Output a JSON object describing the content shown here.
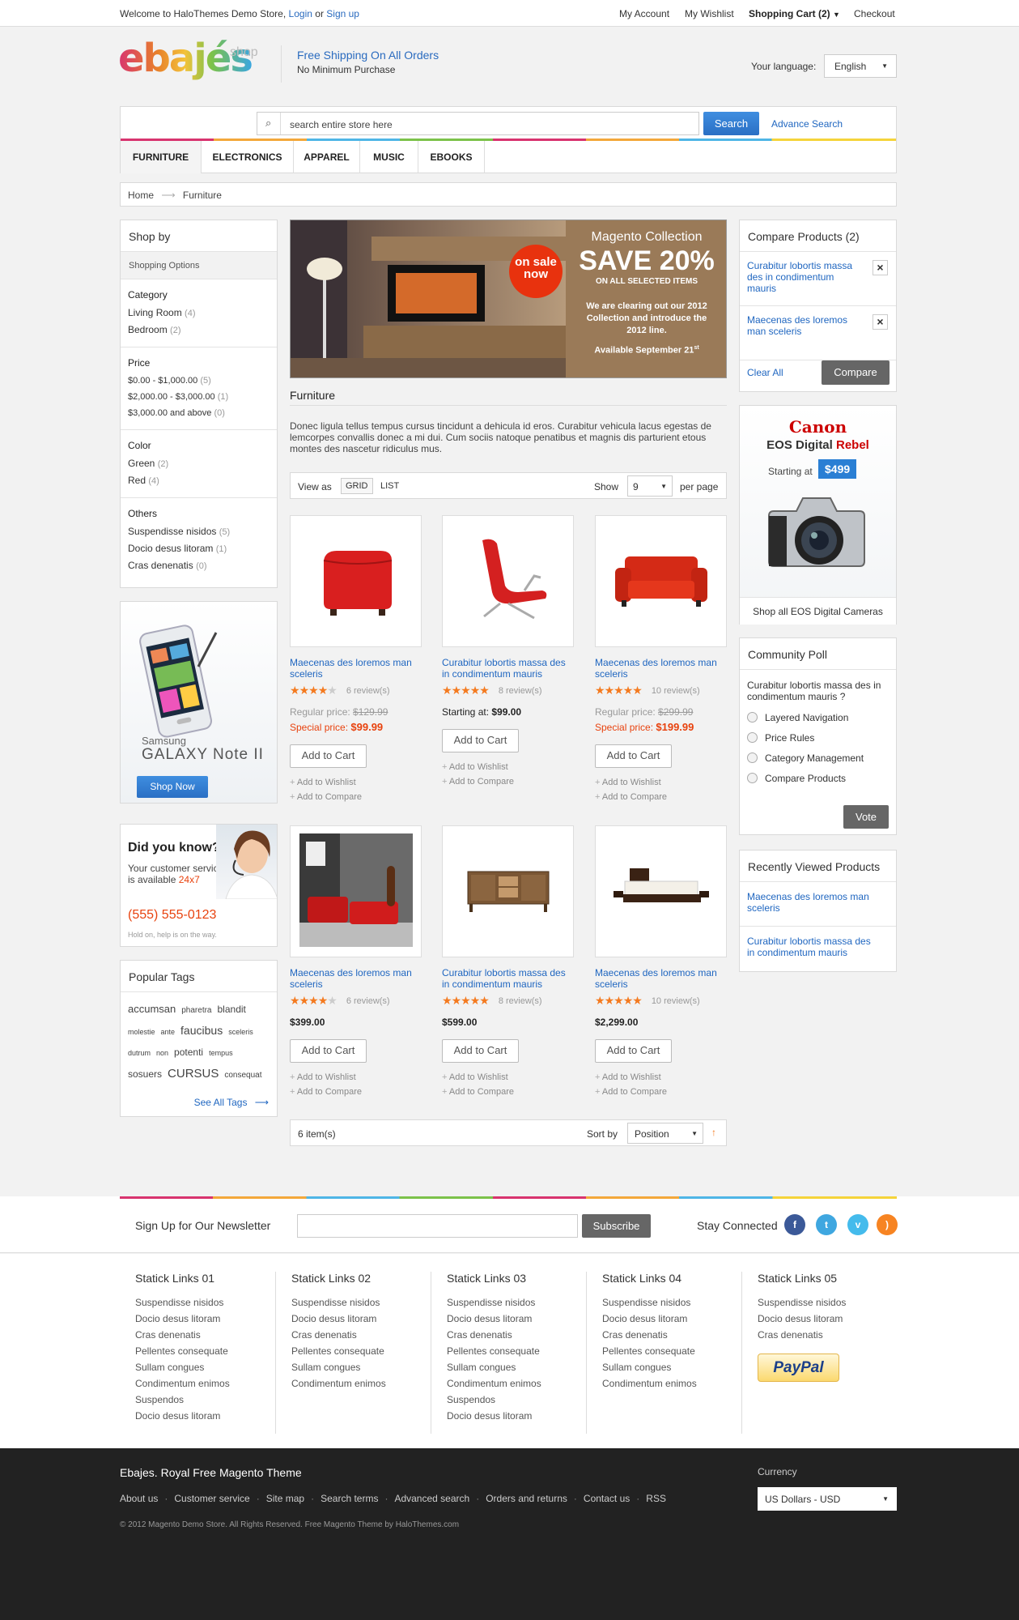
{
  "topbar": {
    "welcome": "Welcome to HaloThemes Demo Store,",
    "login": "Login",
    "or": "or",
    "signup": "Sign up",
    "my_account": "My Account",
    "my_wishlist": "My Wishlist",
    "shopping_cart": "Shopping Cart (2)",
    "checkout": "Checkout"
  },
  "header": {
    "logo_text": "ebajés",
    "logo_shop": "shop",
    "shipping_title": "Free Shipping On All Orders",
    "shipping_sub": "No Minimum Purchase",
    "language_label": "Your language:",
    "language_value": "English"
  },
  "search": {
    "placeholder": "search entire store here",
    "button": "Search",
    "advance": "Advance Search"
  },
  "nav": [
    "FURNITURE",
    "ELECTRONICS",
    "APPAREL",
    "MUSIC",
    "EBOOKS"
  ],
  "breadcrumb": {
    "home": "Home",
    "current": "Furniture"
  },
  "shopby": {
    "title": "Shop by",
    "subtitle": "Shopping Options",
    "groups": [
      {
        "title": "Category",
        "items": [
          {
            "label": "Living Room",
            "count": "(4)"
          },
          {
            "label": "Bedroom",
            "count": "(2)"
          }
        ]
      },
      {
        "title": "Price",
        "items": [
          {
            "label": "$0.00 - $1,000.00",
            "count": "(5)"
          },
          {
            "label": "$2,000.00 - $3,000.00",
            "count": "(1)"
          },
          {
            "label": "$3,000.00 and above",
            "count": "(0)"
          }
        ]
      },
      {
        "title": "Color",
        "items": [
          {
            "label": "Green",
            "count": "(2)"
          },
          {
            "label": "Red",
            "count": "(4)"
          }
        ]
      },
      {
        "title": "Others",
        "items": [
          {
            "label": "Suspendisse nisidos",
            "count": "(5)"
          },
          {
            "label": "Docio desus litoram",
            "count": "(1)"
          },
          {
            "label": "Cras denenatis",
            "count": "(0)"
          }
        ]
      }
    ]
  },
  "samsung_ad": {
    "brand": "Samsung",
    "model": "GALAXY Note",
    "model_suffix": "II",
    "button": "Shop Now"
  },
  "did_you_know": {
    "title": "Did you know?",
    "line1": "Your customer service",
    "line2": "is available",
    "hours": "24x7",
    "phone": "(555) 555-0123",
    "note": "Hold on, help is on the way."
  },
  "tags": {
    "title": "Popular Tags",
    "rows": [
      [
        {
          "t": "accumsan",
          "s": 13
        },
        {
          "t": "pharetra",
          "s": 10
        },
        {
          "t": "blandit",
          "s": 12
        }
      ],
      [
        {
          "t": "molestie",
          "s": 9
        },
        {
          "t": "ante",
          "s": 9
        },
        {
          "t": "faucibus",
          "s": 14
        },
        {
          "t": "sceleris",
          "s": 9
        }
      ],
      [
        {
          "t": "dutrum",
          "s": 9
        },
        {
          "t": "non",
          "s": 9
        },
        {
          "t": "potenti",
          "s": 12
        },
        {
          "t": "tempus",
          "s": 9
        }
      ],
      [
        {
          "t": "sosuers",
          "s": 12
        },
        {
          "t": "CURSUS",
          "s": 15
        },
        {
          "t": "consequat",
          "s": 10
        }
      ]
    ],
    "see_all": "See All Tags"
  },
  "banner": {
    "on_sale": "on sale",
    "now": "now",
    "collection": "Magento Collection",
    "save": "SAVE 20%",
    "on_all": "ON ALL SELECTED ITEMS",
    "desc": "We are clearing out our 2012 Collection and introduce the 2012 line.",
    "available": "Available September 21",
    "available_sup": "st"
  },
  "category": {
    "title": "Furniture",
    "description": "Donec ligula tellus tempus cursus tincidunt a dehicula id eros. Curabitur vehicula lacus egestas de lemcorpes convallis donec a mi dui. Cum sociis natoque penatibus et magnis dis parturient etous montes des nascetur ridiculus mus."
  },
  "toolbar": {
    "view_as": "View as",
    "grid": "GRID",
    "list": "LIST",
    "show": "Show",
    "show_value": "9",
    "per_page": "per page"
  },
  "products": [
    {
      "name": "Maecenas des loremos man sceleris",
      "rating": 3.5,
      "reviews": "6 review(s)",
      "regular_label": "Regular price:",
      "regular": "$129.99",
      "special_label": "Special price:",
      "special": "$99.99",
      "cart": "Add to Cart",
      "wishlist": "Add to Wishlist",
      "compare": "Add to Compare",
      "image": "red-ottoman"
    },
    {
      "name": "Curabitur lobortis massa des in condimentum mauris",
      "rating": 5,
      "reviews": "8 review(s)",
      "starting": "Starting at:",
      "price": "$99.00",
      "cart": "Add to Cart",
      "wishlist": "Add to Wishlist",
      "compare": "Add to Compare",
      "image": "red-chair"
    },
    {
      "name": "Maecenas des loremos man sceleris",
      "rating": 5,
      "reviews": "10 review(s)",
      "regular_label": "Regular price:",
      "regular": "$299.99",
      "special_label": "Special price:",
      "special": "$199.99",
      "cart": "Add to Cart",
      "wishlist": "Add to Wishlist",
      "compare": "Add to Compare",
      "image": "red-sofa"
    },
    {
      "name": "Maecenas des loremos man sceleris",
      "rating": 3.5,
      "reviews": "6 review(s)",
      "price": "$399.00",
      "cart": "Add to Cart",
      "wishlist": "Add to Wishlist",
      "compare": "Add to Compare",
      "image": "red-living-room"
    },
    {
      "name": "Curabitur lobortis massa des in condimentum mauris",
      "rating": 5,
      "reviews": "8 review(s)",
      "price": "$599.00",
      "cart": "Add to Cart",
      "wishlist": "Add to Wishlist",
      "compare": "Add to Compare",
      "image": "wooden-dresser"
    },
    {
      "name": "Maecenas des loremos man sceleris",
      "rating": 5,
      "reviews": "10 review(s)",
      "price": "$2,299.00",
      "cart": "Add to Cart",
      "wishlist": "Add to Wishlist",
      "compare": "Add to Compare",
      "image": "wooden-bed"
    }
  ],
  "bottom_toolbar": {
    "items": "6 item(s)",
    "sort_by": "Sort by",
    "sort_value": "Position"
  },
  "compare": {
    "title": "Compare Products (2)",
    "items": [
      "Curabitur lobortis massa des in condimentum mauris",
      "Maecenas des loremos man sceleris"
    ],
    "clear": "Clear All",
    "button": "Compare"
  },
  "canon_ad": {
    "brand": "Canon",
    "model": "EOS Digital",
    "model2": "Rebel",
    "starting": "Starting at",
    "price": "$499",
    "link": "Shop all EOS Digital Cameras"
  },
  "poll": {
    "title": "Community Poll",
    "question": "Curabitur lobortis massa des in condimentum mauris ?",
    "options": [
      "Layered Navigation",
      "Price Rules",
      "Category Management",
      "Compare Products"
    ],
    "button": "Vote"
  },
  "recent": {
    "title": "Recently Viewed Products",
    "items": [
      "Maecenas des loremos man sceleris",
      "Curabitur lobortis massa des in condimentum mauris"
    ]
  },
  "newsletter": {
    "label": "Sign Up for Our Newsletter",
    "button": "Subscribe",
    "stay": "Stay Connected"
  },
  "footer_links": [
    {
      "title": "Statick Links 01",
      "items": [
        "Suspendisse nisidos",
        "Docio desus litoram",
        "Cras denenatis",
        "Pellentes consequate",
        "Sullam congues",
        "Condimentum enimos",
        "Suspendos",
        "Docio desus litoram"
      ]
    },
    {
      "title": "Statick Links 02",
      "items": [
        "Suspendisse nisidos",
        "Docio desus litoram",
        "Cras denenatis",
        "Pellentes consequate",
        "Sullam congues",
        "Condimentum enimos"
      ]
    },
    {
      "title": "Statick Links 03",
      "items": [
        "Suspendisse nisidos",
        "Docio desus litoram",
        "Cras denenatis",
        "Pellentes consequate",
        "Sullam congues",
        "Condimentum enimos",
        "Suspendos",
        "Docio desus litoram"
      ]
    },
    {
      "title": "Statick Links 04",
      "items": [
        "Suspendisse nisidos",
        "Docio desus litoram",
        "Cras denenatis",
        "Pellentes consequate",
        "Sullam congues",
        "Condimentum enimos"
      ]
    },
    {
      "title": "Statick Links 05",
      "items": [
        "Suspendisse nisidos",
        "Docio desus litoram",
        "Cras denenatis"
      ]
    }
  ],
  "paypal": "PayPal",
  "footer": {
    "brand": "Ebajes. Royal Free Magento Theme",
    "links": [
      "About us",
      "Customer service",
      "Site map",
      "Search terms",
      "Advanced search",
      "Orders and returns",
      "Contact us",
      "RSS"
    ],
    "copyright": "© 2012 Magento Demo Store. All Rights Reserved. Free Magento Theme by HaloThemes.com",
    "currency_label": "Currency",
    "currency_value": "US Dollars - USD"
  },
  "colors": {
    "accent_blue": "#2a7fd4",
    "orange": "#f47a1f",
    "special_red": "#e8420e",
    "footer_bg": "#222222"
  }
}
